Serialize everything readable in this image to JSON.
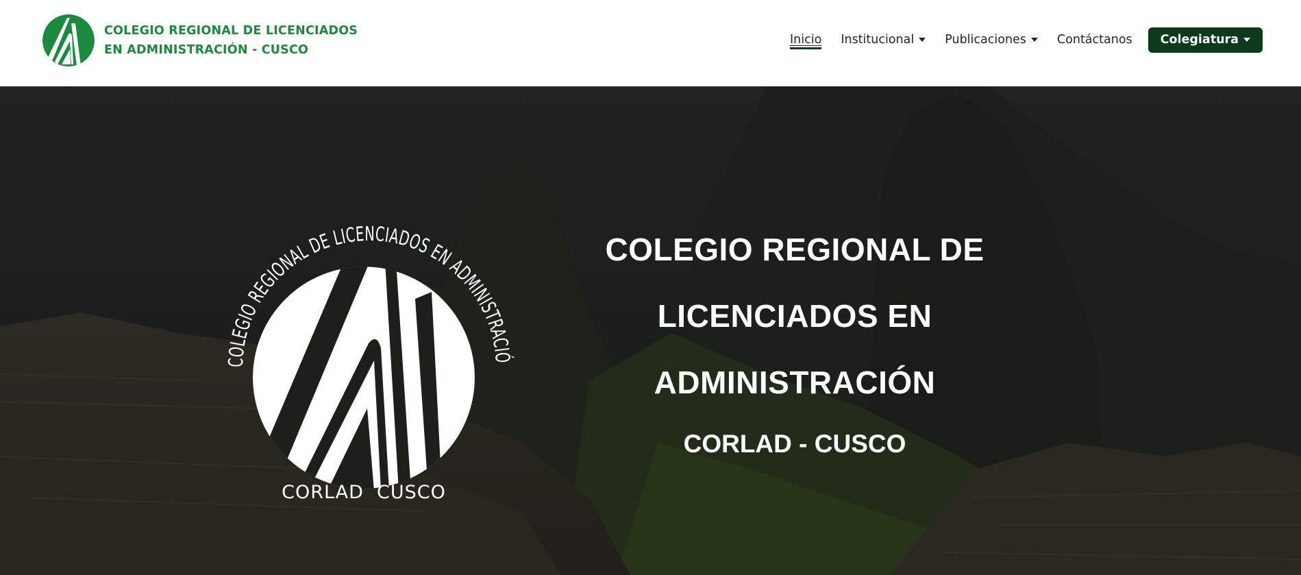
{
  "header": {
    "brand": {
      "line1": "COLEGIO REGIONAL DE LICENCIADOS",
      "line2": "EN ADMINISTRACIÓN - CUSCO",
      "logo_icon": "corlad-logo-icon"
    },
    "nav": {
      "inicio": "Inicio",
      "institucional": "Institucional",
      "publicaciones": "Publicaciones",
      "contactanos": "Contáctanos",
      "colegiatura": "Colegiatura"
    }
  },
  "hero": {
    "background": "machu-picchu-photo",
    "seal": {
      "ring_text": "COLEGIO REGIONAL DE LICENCIADOS EN ADMINISTRACIÓN",
      "bottom_text": "CORLAD  CUSCO"
    },
    "title_line1": "COLEGIO REGIONAL DE",
    "title_line2": "LICENCIADOS EN",
    "title_line3": "ADMINISTRACIÓN",
    "subtitle": "CORLAD - CUSCO"
  },
  "colors": {
    "brand_green": "#1a8a3c",
    "button_dark_green": "#0b3a1c",
    "nav_text": "#1b2a1e"
  }
}
